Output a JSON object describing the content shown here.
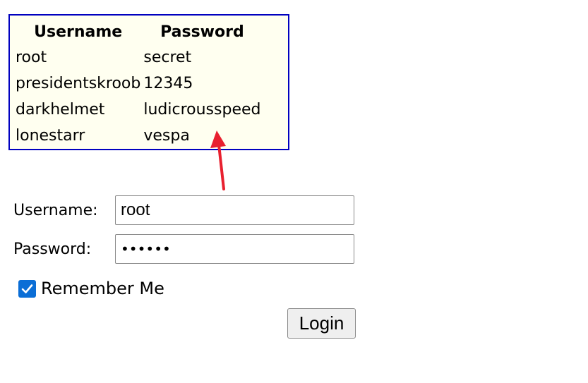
{
  "credentials_table": {
    "headers": [
      "Username",
      "Password"
    ],
    "rows": [
      [
        "root",
        "secret"
      ],
      [
        "presidentskroob",
        "12345"
      ],
      [
        "darkhelmet",
        "ludicrousspeed"
      ],
      [
        "lonestarr",
        "vespa"
      ]
    ],
    "background_color": "#fffff0",
    "border_color": "#0000c0"
  },
  "annotation": {
    "arrow_color": "#e8202f"
  },
  "login_form": {
    "username_label": "Username:",
    "username_value": "root",
    "password_label": "Password:",
    "password_value": "secret",
    "remember_label": "Remember Me",
    "remember_checked": true,
    "login_button_label": "Login",
    "accent_color": "#0b6ed6"
  }
}
